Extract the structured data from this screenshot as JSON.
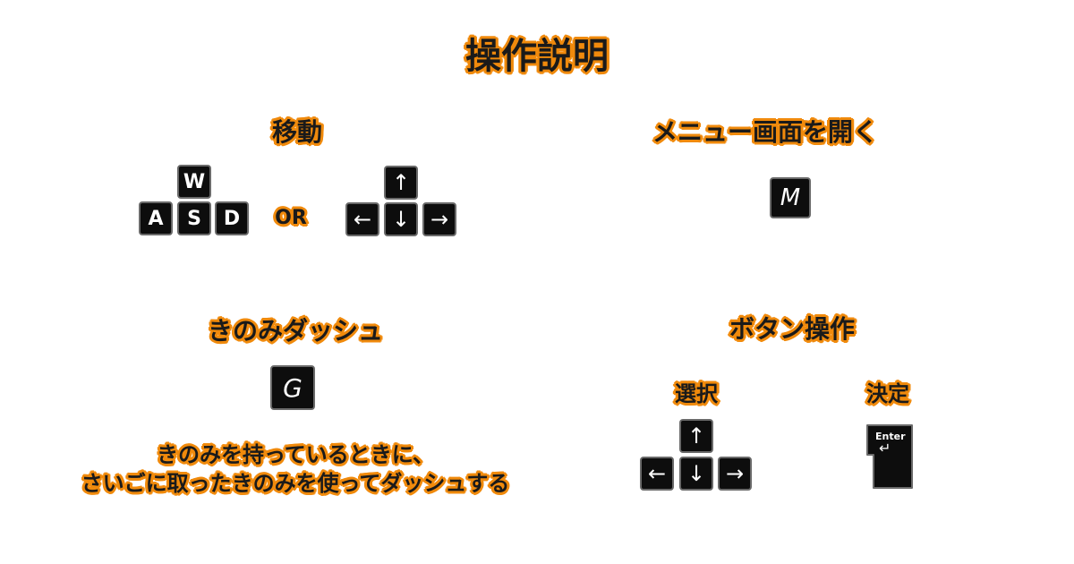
{
  "title": "操作説明",
  "move": {
    "heading": "移動",
    "wasd": [
      "W",
      "A",
      "S",
      "D"
    ],
    "or": "OR",
    "arrows": [
      "↑",
      "←",
      "↓",
      "→"
    ]
  },
  "menu": {
    "heading": "メニュー画面を開く",
    "key": "M"
  },
  "dash": {
    "heading": "きのみダッシュ",
    "key": "G",
    "description_line1": "きのみを持っているときに、",
    "description_line2": "さいごに取ったきのみを使ってダッシュする"
  },
  "buttons": {
    "heading": "ボタン操作",
    "select_label": "選択",
    "select_arrows": [
      "↑",
      "←",
      "↓",
      "→"
    ],
    "confirm_label": "決定",
    "enter_key": "Enter",
    "enter_symbol": "↵"
  }
}
